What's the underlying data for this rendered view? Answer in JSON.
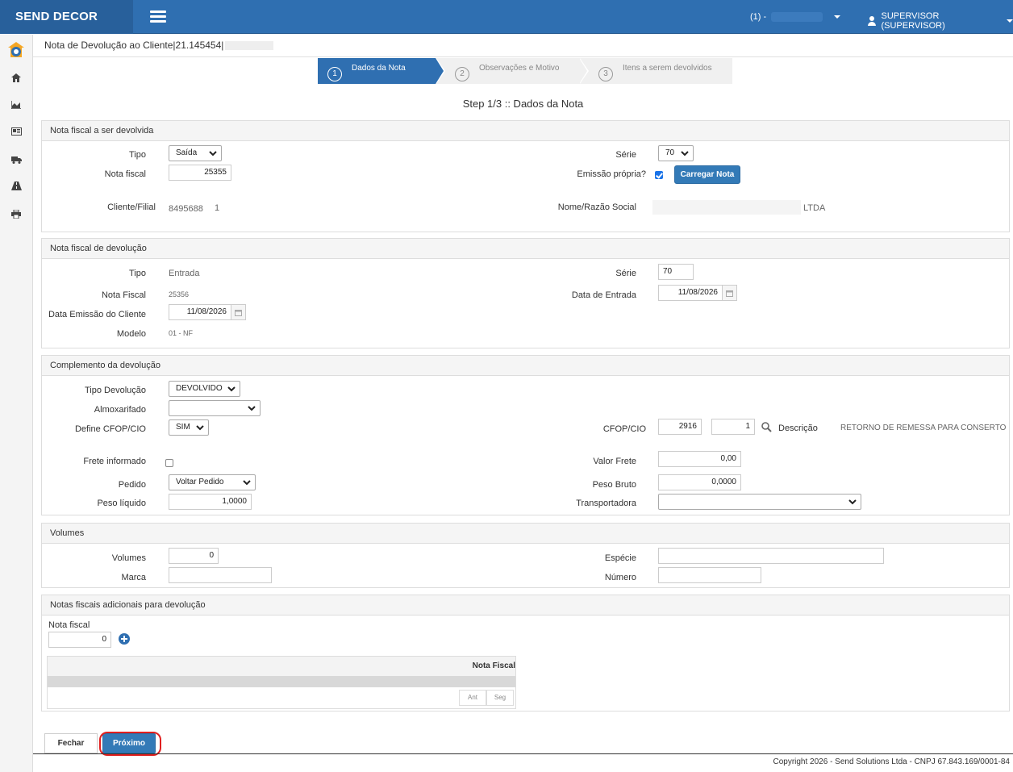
{
  "header": {
    "brand": "SEND DECOR",
    "company_selector": "(1) -",
    "user": "SUPERVISOR (SUPERVISOR)"
  },
  "sidebar": {
    "icons": [
      "app-logo-icon",
      "home-icon",
      "chart-icon",
      "id-card-icon",
      "truck-icon",
      "road-icon",
      "print-icon"
    ]
  },
  "breadcrumb": "Nota de Devolução ao Cliente|21.145454|",
  "wizard": {
    "steps": [
      {
        "num": "1",
        "label": "Dados da Nota"
      },
      {
        "num": "2",
        "label": "Observações e Motivo"
      },
      {
        "num": "3",
        "label": "Itens a serem devolvidos"
      }
    ],
    "active": "1",
    "title": "Step 1/3 :: Dados da Nota"
  },
  "nota_devolvida": {
    "heading": "Nota fiscal a ser devolvida",
    "tipo_label": "Tipo",
    "tipo_value": "Saída",
    "nota_label": "Nota fiscal",
    "nota_value": "25355",
    "cliente_label": "Cliente/Filial",
    "cliente_code": "8495688",
    "filial": "1",
    "serie_label": "Série",
    "serie_value": "70",
    "emissao_label": "Emissão própria?",
    "emissao_checked": true,
    "carregar_label": "Carregar Nota",
    "razao_label": "Nome/Razão Social",
    "razao_suffix": "LTDA"
  },
  "nota_devolucao": {
    "heading": "Nota fiscal de devolução",
    "tipo_label": "Tipo",
    "tipo_value": "Entrada",
    "nota_label": "Nota Fiscal",
    "nota_value": "25356",
    "data_emissao_label": "Data Emissão do Cliente",
    "data_emissao_value": "11/08/2026",
    "modelo_label": "Modelo",
    "modelo_value": "01 - NF",
    "serie_label": "Série",
    "serie_value": "70",
    "data_entrada_label": "Data de Entrada",
    "data_entrada_value": "11/08/2026"
  },
  "complemento": {
    "heading": "Complemento da devolução",
    "tipo_dev_label": "Tipo Devolução",
    "tipo_dev_value": "DEVOLVIDO",
    "almox_label": "Almoxarifado",
    "almox_value": "",
    "cfop_def_label": "Define CFOP/CIO",
    "cfop_def_value": "SIM",
    "frete_inf_label": "Frete informado",
    "frete_inf_checked": false,
    "pedido_label": "Pedido",
    "pedido_value": "Voltar Pedido",
    "peso_liq_label": "Peso líquido",
    "peso_liq_value": "1,0000",
    "cfop_label": "CFOP/CIO",
    "cfop_value": "2916",
    "cfop_seq": "1",
    "descricao_label": "Descrição",
    "descricao_value": "RETORNO DE REMESSA PARA CONSERTO",
    "valor_frete_label": "Valor Frete",
    "valor_frete_value": "0,00",
    "peso_bruto_label": "Peso Bruto",
    "peso_bruto_value": "0,0000",
    "transp_label": "Transportadora",
    "transp_value": ""
  },
  "volumes": {
    "heading": "Volumes",
    "volumes_label": "Volumes",
    "volumes_value": "0",
    "marca_label": "Marca",
    "marca_value": "",
    "especie_label": "Espécie",
    "especie_value": "",
    "numero_label": "Número",
    "numero_value": ""
  },
  "adicionais": {
    "heading": "Notas fiscais adicionais para devolução",
    "nota_label": "Nota fiscal",
    "nota_value": "0",
    "grid_header": "Nota Fiscal",
    "prev": "Ant",
    "next": "Seg"
  },
  "footer": {
    "fechar": "Fechar",
    "proximo": "Próximo",
    "copyright": "Copyright 2026 - Send Solutions Ltda - CNPJ 67.843.169/0001-84"
  },
  "colors": {
    "primary": "#2f6fb1",
    "button": "#337ab7",
    "highlight": "#e02020"
  }
}
